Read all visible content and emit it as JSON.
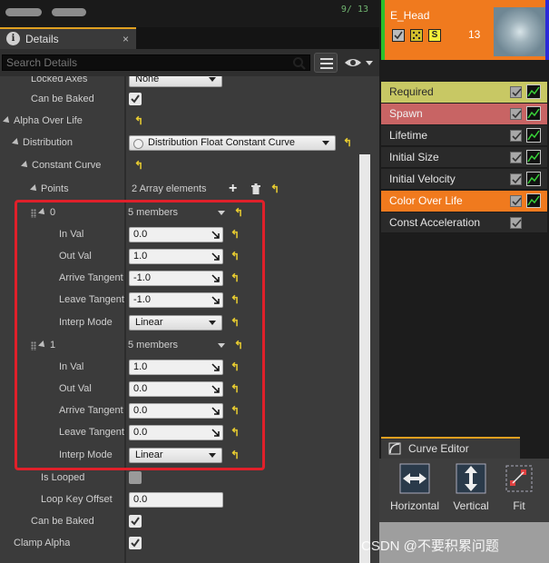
{
  "top": {
    "counter": "9/ 13"
  },
  "tab": {
    "title": "Details"
  },
  "search": {
    "placeholder": "Search Details"
  },
  "rows": {
    "locked_axes": {
      "label": "Locked Axes",
      "value": "None"
    },
    "can_be_baked_1": {
      "label": "Can be Baked",
      "checked": true
    },
    "alpha_over_life": {
      "label": "Alpha Over Life"
    },
    "distribution": {
      "label": "Distribution",
      "value": "Distribution Float Constant Curve"
    },
    "constant_curve": {
      "label": "Constant Curve"
    },
    "points": {
      "label": "Points",
      "value": "2 Array elements"
    },
    "is_looped": {
      "label": "Is Looped",
      "checked": false
    },
    "loop_key_offset": {
      "label": "Loop Key Offset",
      "value": "0.0"
    },
    "can_be_baked_2": {
      "label": "Can be Baked",
      "checked": true
    },
    "clamp_alpha": {
      "label": "Clamp Alpha",
      "checked": true
    }
  },
  "points": [
    {
      "index": "0",
      "members": "5 members",
      "in_val": {
        "label": "In Val",
        "value": "0.0"
      },
      "out_val": {
        "label": "Out Val",
        "value": "1.0"
      },
      "arrive": {
        "label": "Arrive Tangent",
        "value": "-1.0"
      },
      "leave": {
        "label": "Leave Tangent",
        "value": "-1.0"
      },
      "interp": {
        "label": "Interp Mode",
        "value": "Linear"
      }
    },
    {
      "index": "1",
      "members": "5 members",
      "in_val": {
        "label": "In Val",
        "value": "1.0"
      },
      "out_val": {
        "label": "Out Val",
        "value": "0.0"
      },
      "arrive": {
        "label": "Arrive Tangent",
        "value": "0.0"
      },
      "leave": {
        "label": "Leave Tangent",
        "value": "0.0"
      },
      "interp": {
        "label": "Interp Mode",
        "value": "Linear"
      }
    }
  ],
  "emitter": {
    "name": "E_Head",
    "count": "13",
    "solo_label": "S",
    "modules": [
      {
        "label": "Required",
        "color": "#c8c864",
        "text": "#2a2a2a"
      },
      {
        "label": "Spawn",
        "color": "#c86464",
        "text": "#f0f0f0"
      },
      {
        "label": "Lifetime",
        "color": "#2a2a2a",
        "text": "#e6e6e6"
      },
      {
        "label": "Initial Size",
        "color": "#2a2a2a",
        "text": "#e6e6e6"
      },
      {
        "label": "Initial Velocity",
        "color": "#2a2a2a",
        "text": "#e6e6e6"
      },
      {
        "label": "Color Over Life",
        "color": "#f07a1e",
        "text": "#ffffff"
      },
      {
        "label": "Const Acceleration",
        "color": "#2a2a2a",
        "text": "#e6e6e6"
      }
    ]
  },
  "curve_editor": {
    "title": "Curve Editor",
    "buttons": {
      "horizontal": "Horizontal",
      "vertical": "Vertical",
      "fit": "Fit"
    }
  },
  "watermark": "CSDN @不要积累问题",
  "colors": {
    "accent": "#e0a020",
    "highlight_box": "#e0202a",
    "reset_arrow": "#e8cc30"
  }
}
